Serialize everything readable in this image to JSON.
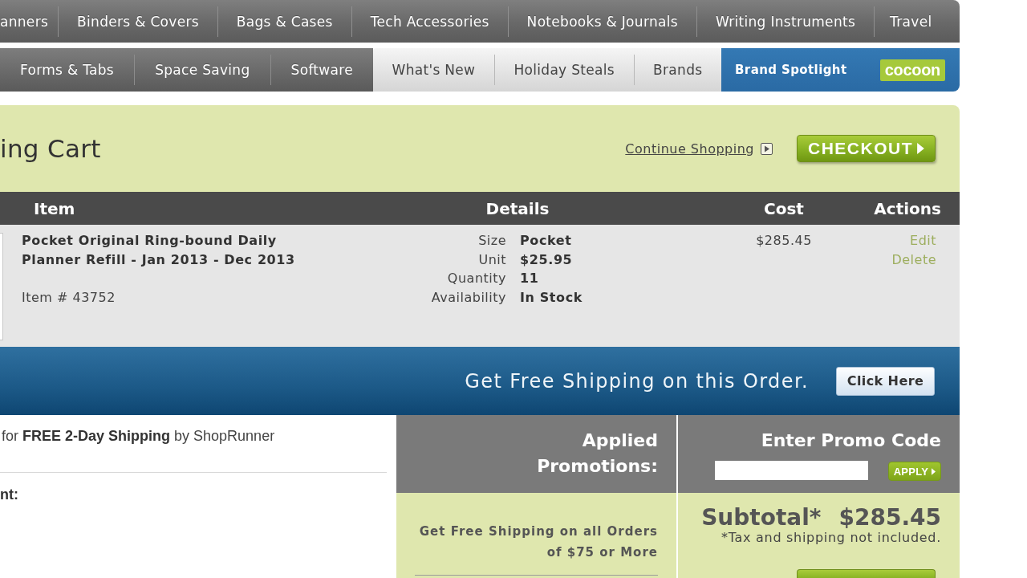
{
  "nav_primary": [
    "anners",
    "Binders & Covers",
    "Bags & Cases",
    "Tech Accessories",
    "Notebooks & Journals",
    "Writing Instruments",
    "Travel"
  ],
  "nav_secondary": {
    "categories": [
      "Forms & Tabs",
      "Space Saving",
      "Software"
    ],
    "featured": [
      "What's New",
      "Holiday Steals",
      "Brands"
    ],
    "spotlight": {
      "label": "Brand Spotlight",
      "logo_text": "cocoon"
    }
  },
  "cart": {
    "title": "ing Cart",
    "continue_link": "Continue Shopping",
    "checkout_button": "CHECKOUT",
    "table": {
      "columns": [
        "Item",
        "Details",
        "Cost",
        "Actions"
      ],
      "rows": [
        {
          "name": "Pocket Original Ring-bound Daily Planner Refill - Jan 2013 - Dec 2013",
          "item_number": "Item # 43752",
          "details": [
            {
              "label": "Size",
              "value": "Pocket"
            },
            {
              "label": "Unit",
              "value": "$25.95"
            },
            {
              "label": "Quantity",
              "value": "11"
            },
            {
              "label": "Availability",
              "value": "In Stock"
            }
          ],
          "cost": "$285.45",
          "actions": [
            "Edit",
            "Delete"
          ]
        }
      ]
    }
  },
  "shipping_banner": {
    "text": "Get Free Shipping on this Order.",
    "button": "Click Here"
  },
  "shoprunner": {
    "text": "for **FREE 2-Day Shipping** by ShopRunner",
    "section_label": "nt:"
  },
  "promotions": {
    "heading": "Applied Promotions:",
    "items": [
      "Get Free Shipping on all Orders of $75 or More"
    ]
  },
  "promo_code": {
    "heading": "Enter Promo Code",
    "apply_button": "APPLY"
  },
  "summary": {
    "subtotal_label": "Subtotal*",
    "subtotal_value": "$285.45",
    "note": "*Tax and shipping not included."
  }
}
